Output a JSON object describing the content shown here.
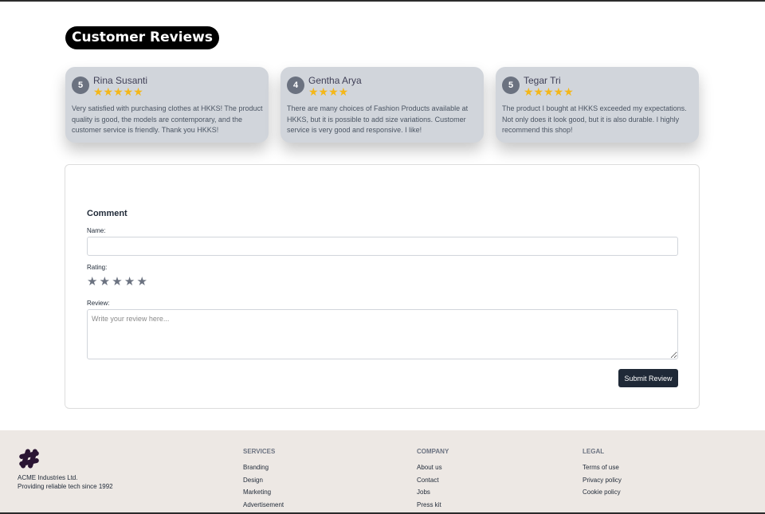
{
  "page_title": "Customer Reviews",
  "reviews": [
    {
      "rating": "5",
      "name": "Rina Susanti",
      "stars": "★★★★★",
      "text": "Very satisfied with purchasing clothes at HKKS! The product quality is good, the models are contemporary, and the customer service is friendly. Thank you HKKS!"
    },
    {
      "rating": "4",
      "name": "Gentha Arya",
      "stars": "★★★★",
      "text": "There are many choices of Fashion Products available at HKKS, but it is possible to add size variations. Customer service is very good and responsive. I like!"
    },
    {
      "rating": "5",
      "name": "Tegar Tri",
      "stars": "★★★★★",
      "text": "The product I bought at HKKS exceeded my expectations. Not only does it look good, but it is also durable. I highly recommend this shop!"
    }
  ],
  "form": {
    "title": "Comment",
    "name_label": "Name:",
    "name_value": "",
    "rating_label": "Rating:",
    "rating_value": 0,
    "rating_stars": [
      "★",
      "★",
      "★",
      "★",
      "★"
    ],
    "review_label": "Review:",
    "review_placeholder": "Write your review here...",
    "submit_label": "Submit Review"
  },
  "footer": {
    "company_name": "ACME Industries Ltd.",
    "tagline": "Providing reliable tech since 1992",
    "columns": [
      {
        "title": "SERVICES",
        "links": [
          "Branding",
          "Design",
          "Marketing",
          "Advertisement"
        ]
      },
      {
        "title": "COMPANY",
        "links": [
          "About us",
          "Contact",
          "Jobs",
          "Press kit"
        ]
      },
      {
        "title": "LEGAL",
        "links": [
          "Terms of use",
          "Privacy policy",
          "Cookie policy"
        ]
      }
    ]
  },
  "colors": {
    "star_filled": "#f4b718",
    "star_empty": "#6b7280",
    "card_bg": "#d1d5db",
    "button_bg": "#1f2937",
    "footer_bg": "#ede8e4",
    "logo": "#2a1533"
  },
  "icons": {
    "logo": "hash-logo-icon",
    "star": "star-icon"
  }
}
